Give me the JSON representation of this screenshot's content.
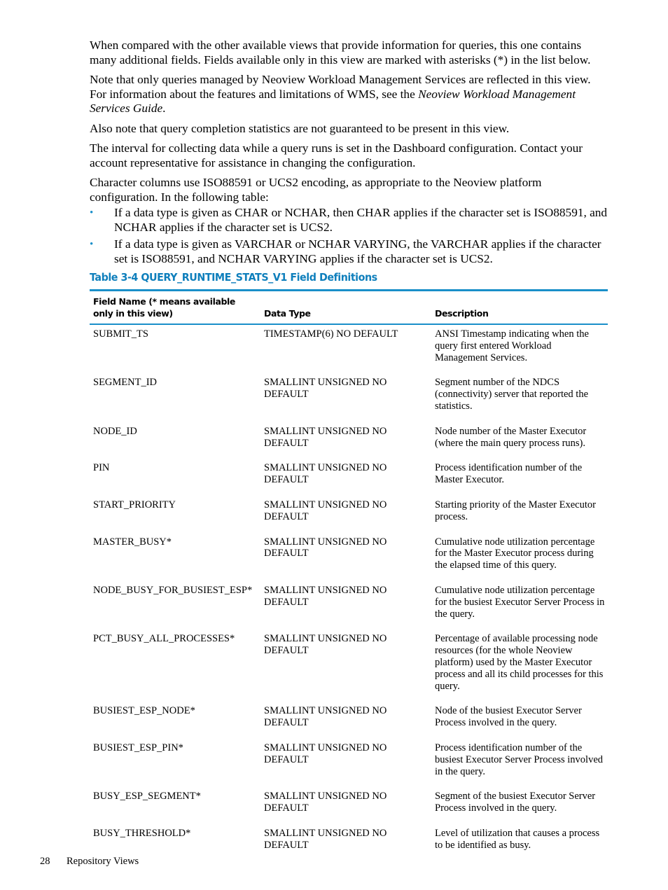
{
  "paragraphs": {
    "p1": "When compared with the other available views that provide information for queries, this one contains many additional fields. Fields available only in this view are marked with asterisks (*) in the list below.",
    "p2_before": "Note that only queries managed by Neoview Workload Management Services are reflected in this view. For information about the features and limitations of WMS, see the ",
    "p2_italic": "Neoview Workload Management Services Guide",
    "p2_after": ".",
    "p3": "Also note that query completion statistics are not guaranteed to be present in this view.",
    "p4": "The interval for collecting data while a query runs is set in the Dashboard configuration. Contact your account representative for assistance in changing the configuration.",
    "p5": "Character columns use ISO88591 or UCS2 encoding, as appropriate to the Neoview platform configuration. In the following table:"
  },
  "bullets": [
    "If a data type is given as CHAR or NCHAR, then CHAR applies if the character set is ISO88591, and NCHAR applies if the character set is UCS2.",
    "If a data type is given as VARCHAR or NCHAR VARYING, the VARCHAR applies if the character set is ISO88591, and NCHAR VARYING applies if the character set is UCS2."
  ],
  "bullet_glyph": "•",
  "table": {
    "title": "Table  3-4  QUERY_RUNTIME_STATS_V1 Field Definitions",
    "headers": [
      "Field Name (* means available only in this view)",
      "Data Type",
      "Description"
    ],
    "rows": [
      [
        "SUBMIT_TS",
        "TIMESTAMP(6) NO DEFAULT",
        "ANSI Timestamp indicating when the query first entered Workload Management Services."
      ],
      [
        "SEGMENT_ID",
        "SMALLINT UNSIGNED NO DEFAULT",
        "Segment number of the NDCS (connectivity) server that reported the statistics."
      ],
      [
        "NODE_ID",
        "SMALLINT UNSIGNED NO DEFAULT",
        "Node number of the Master Executor (where the main query process runs)."
      ],
      [
        "PIN",
        "SMALLINT UNSIGNED NO DEFAULT",
        "Process identification number of the Master Executor."
      ],
      [
        "START_PRIORITY",
        "SMALLINT UNSIGNED NO DEFAULT",
        "Starting priority of the Master Executor process."
      ],
      [
        "MASTER_BUSY*",
        "SMALLINT UNSIGNED NO DEFAULT",
        "Cumulative node utilization percentage for the Master Executor process during the elapsed time of this query."
      ],
      [
        "NODE_BUSY_FOR_BUSIEST_ESP*",
        "SMALLINT UNSIGNED NO DEFAULT",
        "Cumulative node utilization percentage for the busiest Executor Server Process in the query."
      ],
      [
        "PCT_BUSY_ALL_PROCESSES*",
        "SMALLINT UNSIGNED NO DEFAULT",
        "Percentage of available processing node resources (for the whole Neoview platform) used by the Master Executor process and all its child processes for this query."
      ],
      [
        "BUSIEST_ESP_NODE*",
        "SMALLINT UNSIGNED NO DEFAULT",
        "Node of the busiest Executor Server Process involved in the query."
      ],
      [
        "BUSIEST_ESP_PIN*",
        "SMALLINT UNSIGNED NO DEFAULT",
        "Process identification number of the busiest Executor Server Process involved in the query."
      ],
      [
        "BUSY_ESP_SEGMENT*",
        "SMALLINT UNSIGNED NO DEFAULT",
        "Segment of the busiest Executor Server Process involved in the query."
      ],
      [
        "BUSY_THRESHOLD*",
        "SMALLINT UNSIGNED NO DEFAULT",
        "Level of utilization that causes a process to be identified as busy."
      ]
    ]
  },
  "footer": {
    "page_number": "28",
    "section": "Repository Views"
  },
  "colors": {
    "accent": "#1a8fc9",
    "title": "#0f7fbc"
  }
}
